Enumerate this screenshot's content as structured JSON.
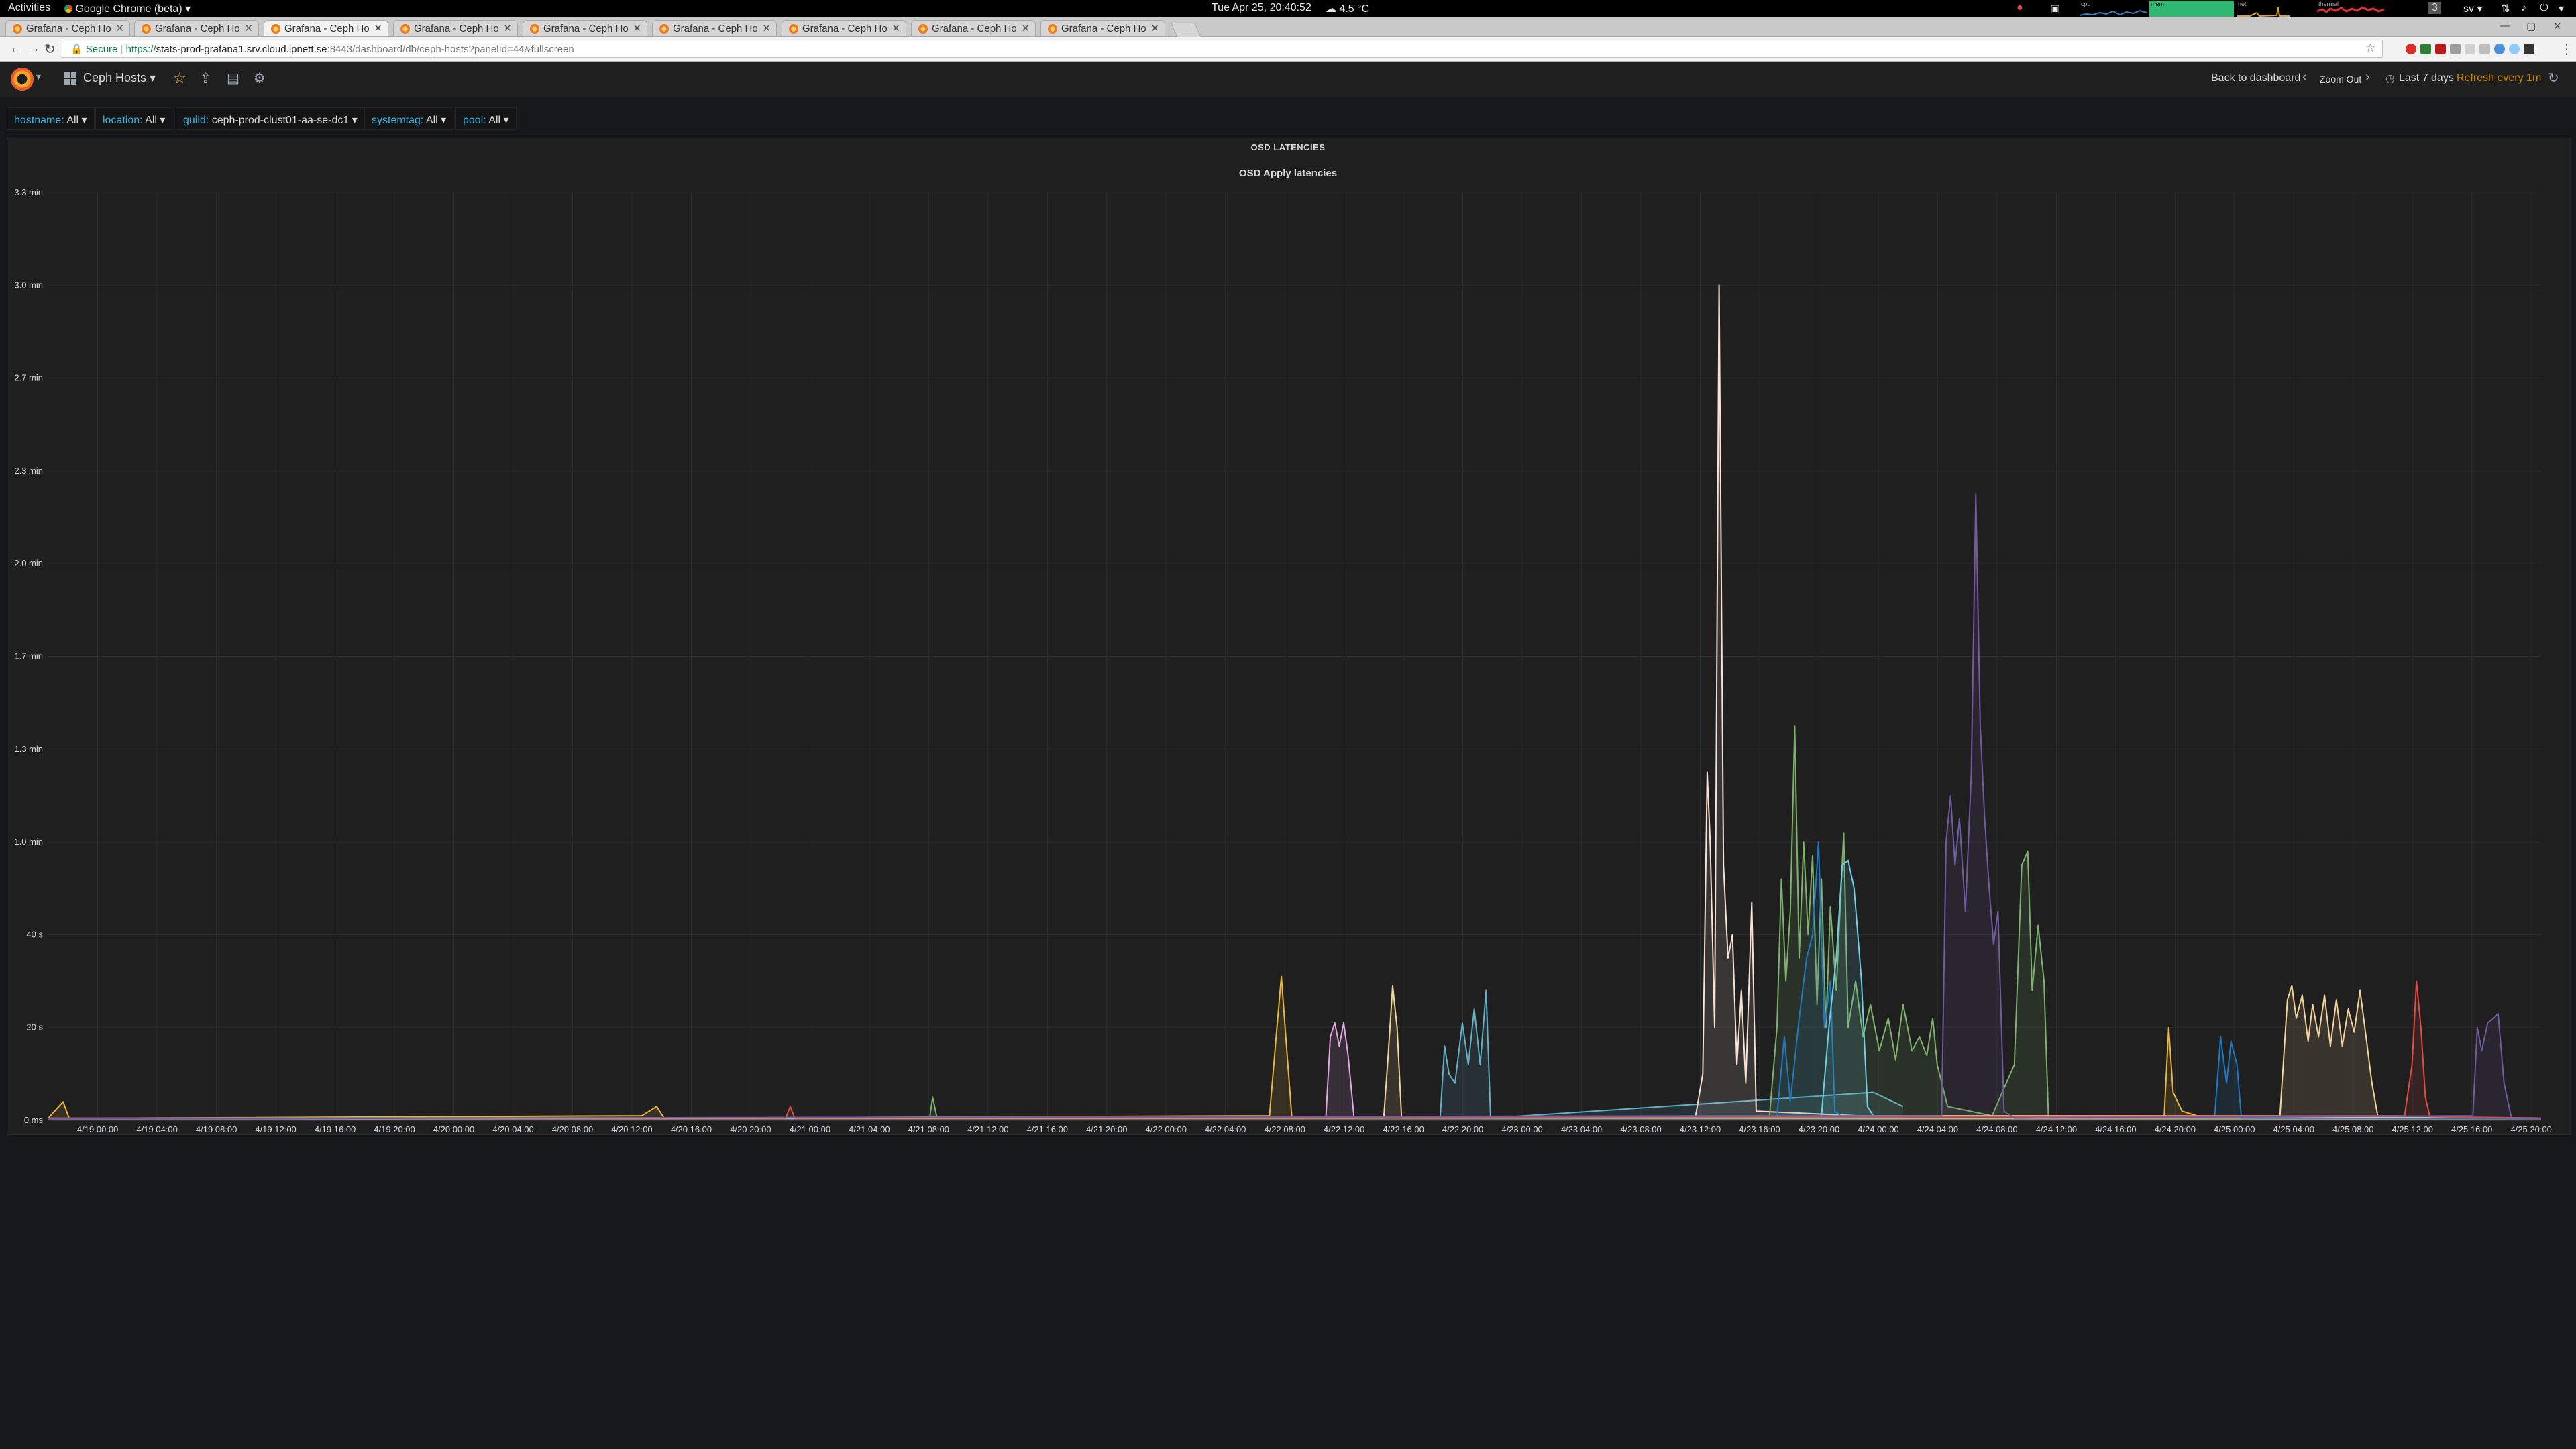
{
  "os_bar": {
    "activities": "Activities",
    "app_menu": "Google Chrome (beta) ▾",
    "clock": "Tue Apr 25, 20:40:52",
    "weather": "4.5 °C",
    "monitor_cpu": "cpu",
    "monitor_mem": "mem",
    "monitor_net": "net",
    "monitor_thermal": "thermal",
    "workspace": "3",
    "keyboard_layout": "sv ▾"
  },
  "browser": {
    "tabs": [
      {
        "title": "Grafana - Ceph Ho"
      },
      {
        "title": "Grafana - Ceph Ho"
      },
      {
        "title": "Grafana - Ceph Ho"
      },
      {
        "title": "Grafana - Ceph Ho"
      },
      {
        "title": "Grafana - Ceph Ho"
      },
      {
        "title": "Grafana - Ceph Ho"
      },
      {
        "title": "Grafana - Ceph Ho"
      },
      {
        "title": "Grafana - Ceph Ho"
      },
      {
        "title": "Grafana - Ceph Ho"
      }
    ],
    "active_tab": 2,
    "security_label": "Secure",
    "url_scheme": "https://",
    "url_host": "stats-prod-grafana1.srv.cloud.ipnett.se",
    "url_path": ":8443/dashboard/db/ceph-hosts?panelId=44&fullscreen"
  },
  "grafana": {
    "dashboard_title": "Ceph Hosts ▾",
    "back_to_dashboard": "Back to dashboard",
    "zoom_out": "Zoom Out",
    "time_range": "Last 7 days",
    "refresh": "Refresh every 1m",
    "refresh_color": "#c98800",
    "variables": [
      {
        "label": "hostname:",
        "value": "All ▾"
      },
      {
        "label": "location:",
        "value": "All ▾"
      },
      {
        "label": "guild:",
        "value": "ceph-prod-clust01-aa-se-dc1 ▾"
      },
      {
        "label": "systemtag:",
        "value": "All ▾"
      },
      {
        "label": "pool:",
        "value": "All ▾"
      }
    ],
    "row_title": "OSD LATENCIES",
    "panel_title": "OSD Apply latencies"
  },
  "chart_data": {
    "type": "line",
    "title": "OSD Apply latencies",
    "y_unit": "seconds",
    "ylim": [
      0,
      200
    ],
    "y_ticks": [
      {
        "v": 0,
        "label": "0 ms"
      },
      {
        "v": 20,
        "label": "20 s"
      },
      {
        "v": 40,
        "label": "40 s"
      },
      {
        "v": 60,
        "label": "1.0 min"
      },
      {
        "v": 80,
        "label": "1.3 min"
      },
      {
        "v": 100,
        "label": "1.7 min"
      },
      {
        "v": 120,
        "label": "2.0 min"
      },
      {
        "v": 140,
        "label": "2.3 min"
      },
      {
        "v": 160,
        "label": "2.7 min"
      },
      {
        "v": 180,
        "label": "3.0 min"
      },
      {
        "v": 200,
        "label": "3.3 min"
      }
    ],
    "x_unit": "hours since 4/18 20:40",
    "xlim": [
      0,
      168
    ],
    "x_ticks": [
      {
        "h": 3.33,
        "label": "4/19 00:00"
      },
      {
        "h": 7.33,
        "label": "4/19 04:00"
      },
      {
        "h": 11.33,
        "label": "4/19 08:00"
      },
      {
        "h": 15.33,
        "label": "4/19 12:00"
      },
      {
        "h": 19.33,
        "label": "4/19 16:00"
      },
      {
        "h": 23.33,
        "label": "4/19 20:00"
      },
      {
        "h": 27.33,
        "label": "4/20 00:00"
      },
      {
        "h": 31.33,
        "label": "4/20 04:00"
      },
      {
        "h": 35.33,
        "label": "4/20 08:00"
      },
      {
        "h": 39.33,
        "label": "4/20 12:00"
      },
      {
        "h": 43.33,
        "label": "4/20 16:00"
      },
      {
        "h": 47.33,
        "label": "4/20 20:00"
      },
      {
        "h": 51.33,
        "label": "4/21 00:00"
      },
      {
        "h": 55.33,
        "label": "4/21 04:00"
      },
      {
        "h": 59.33,
        "label": "4/21 08:00"
      },
      {
        "h": 63.33,
        "label": "4/21 12:00"
      },
      {
        "h": 67.33,
        "label": "4/21 16:00"
      },
      {
        "h": 71.33,
        "label": "4/21 20:00"
      },
      {
        "h": 75.33,
        "label": "4/22 00:00"
      },
      {
        "h": 79.33,
        "label": "4/22 04:00"
      },
      {
        "h": 83.33,
        "label": "4/22 08:00"
      },
      {
        "h": 87.33,
        "label": "4/22 12:00"
      },
      {
        "h": 91.33,
        "label": "4/22 16:00"
      },
      {
        "h": 95.33,
        "label": "4/22 20:00"
      },
      {
        "h": 99.33,
        "label": "4/23 00:00"
      },
      {
        "h": 103.33,
        "label": "4/23 04:00"
      },
      {
        "h": 107.33,
        "label": "4/23 08:00"
      },
      {
        "h": 111.33,
        "label": "4/23 12:00"
      },
      {
        "h": 115.33,
        "label": "4/23 16:00"
      },
      {
        "h": 119.33,
        "label": "4/23 20:00"
      },
      {
        "h": 123.33,
        "label": "4/24 00:00"
      },
      {
        "h": 127.33,
        "label": "4/24 04:00"
      },
      {
        "h": 131.33,
        "label": "4/24 08:00"
      },
      {
        "h": 135.33,
        "label": "4/24 12:00"
      },
      {
        "h": 139.33,
        "label": "4/24 16:00"
      },
      {
        "h": 143.33,
        "label": "4/24 20:00"
      },
      {
        "h": 147.33,
        "label": "4/25 00:00"
      },
      {
        "h": 151.33,
        "label": "4/25 04:00"
      },
      {
        "h": 155.33,
        "label": "4/25 08:00"
      },
      {
        "h": 159.33,
        "label": "4/25 12:00"
      },
      {
        "h": 163.33,
        "label": "4/25 16:00"
      },
      {
        "h": 167.33,
        "label": "4/25 20:00"
      }
    ],
    "grid": true,
    "legend": "none",
    "series": [
      {
        "color": "#eab839",
        "points": [
          [
            0,
            0.5
          ],
          [
            1,
            4
          ],
          [
            1.4,
            0.5
          ],
          [
            6,
            0.5
          ],
          [
            40,
            1
          ],
          [
            41,
            3
          ],
          [
            41.5,
            0.5
          ],
          [
            82.3,
            1
          ],
          [
            82.8,
            20
          ],
          [
            83.1,
            31
          ],
          [
            83.4,
            18
          ],
          [
            83.8,
            0.8
          ],
          [
            93,
            0.5
          ],
          [
            142.6,
            1
          ],
          [
            142.9,
            20
          ],
          [
            143.2,
            6
          ],
          [
            143.8,
            2
          ],
          [
            145,
            0.8
          ],
          [
            168,
            0.5
          ]
        ]
      },
      {
        "color": "#e5a8e2",
        "points": [
          [
            86.1,
            0.5
          ],
          [
            86.4,
            18
          ],
          [
            86.7,
            21
          ],
          [
            87,
            16
          ],
          [
            87.3,
            21
          ],
          [
            87.6,
            14
          ],
          [
            88,
            0.5
          ]
        ]
      },
      {
        "color": "#f4d598",
        "points": [
          [
            0,
            0.3
          ],
          [
            90,
            0.5
          ],
          [
            90.3,
            14
          ],
          [
            90.6,
            29
          ],
          [
            90.9,
            20
          ],
          [
            91.2,
            0.5
          ],
          [
            168,
            0.3
          ]
        ]
      },
      {
        "color": "#64b0c8",
        "points": [
          [
            93.8,
            0.5
          ],
          [
            94.1,
            16
          ],
          [
            94.4,
            10
          ],
          [
            94.8,
            8
          ],
          [
            95.3,
            21
          ],
          [
            95.7,
            12
          ],
          [
            96.1,
            24
          ],
          [
            96.5,
            12
          ],
          [
            96.9,
            28
          ],
          [
            97.2,
            0.5
          ],
          [
            123,
            6
          ],
          [
            125,
            3
          ]
        ]
      },
      {
        "color": "#f9e2d2",
        "points": [
          [
            0,
            0.4
          ],
          [
            111,
            0.6
          ],
          [
            111.5,
            10
          ],
          [
            111.8,
            75
          ],
          [
            112,
            60
          ],
          [
            112.3,
            20
          ],
          [
            112.6,
            180
          ],
          [
            112.9,
            55
          ],
          [
            113.2,
            35
          ],
          [
            113.5,
            40
          ],
          [
            113.8,
            12
          ],
          [
            114.1,
            28
          ],
          [
            114.4,
            8
          ],
          [
            114.8,
            47
          ],
          [
            115.1,
            2
          ],
          [
            122,
            1
          ],
          [
            168,
            0.4
          ]
        ]
      },
      {
        "color": "#7eb26d",
        "points": [
          [
            0,
            0.5
          ],
          [
            59.4,
            0.6
          ],
          [
            59.6,
            5
          ],
          [
            59.9,
            0.5
          ],
          [
            116,
            1
          ],
          [
            116.5,
            20
          ],
          [
            116.8,
            52
          ],
          [
            117.1,
            30
          ],
          [
            117.4,
            45
          ],
          [
            117.7,
            85
          ],
          [
            118,
            35
          ],
          [
            118.3,
            60
          ],
          [
            118.6,
            40
          ],
          [
            118.9,
            57
          ],
          [
            119.2,
            25
          ],
          [
            119.5,
            52
          ],
          [
            119.8,
            20
          ],
          [
            120.1,
            46
          ],
          [
            120.5,
            28
          ],
          [
            121,
            62
          ],
          [
            121.3,
            20
          ],
          [
            121.8,
            30
          ],
          [
            122.3,
            18
          ],
          [
            122.8,
            25
          ],
          [
            123.4,
            15
          ],
          [
            124,
            22
          ],
          [
            124.5,
            13
          ],
          [
            125,
            25
          ],
          [
            125.6,
            15
          ],
          [
            126.1,
            18
          ],
          [
            126.6,
            14
          ],
          [
            127,
            22
          ],
          [
            127.3,
            12
          ],
          [
            128,
            3
          ],
          [
            131,
            1
          ],
          [
            132.5,
            12
          ],
          [
            133,
            55
          ],
          [
            133.4,
            58
          ],
          [
            133.7,
            28
          ],
          [
            134.1,
            42
          ],
          [
            134.5,
            30
          ],
          [
            134.8,
            0.5
          ],
          [
            168,
            0.4
          ]
        ]
      },
      {
        "color": "#1f78c1",
        "points": [
          [
            0,
            0.3
          ],
          [
            116.5,
            1
          ],
          [
            117,
            18
          ],
          [
            117.4,
            4
          ],
          [
            118,
            22
          ],
          [
            118.5,
            35
          ],
          [
            118.9,
            40
          ],
          [
            119.3,
            60
          ],
          [
            119.7,
            20
          ],
          [
            120.1,
            30
          ],
          [
            120.4,
            2
          ],
          [
            120.8,
            1
          ],
          [
            146,
            0.8
          ],
          [
            146.4,
            18
          ],
          [
            146.8,
            8
          ],
          [
            147.1,
            17
          ],
          [
            147.5,
            12
          ],
          [
            147.8,
            0.5
          ],
          [
            168,
            0.3
          ]
        ]
      },
      {
        "color": "#6ed0e0",
        "points": [
          [
            119.5,
            1
          ],
          [
            120,
            20
          ],
          [
            120.5,
            35
          ],
          [
            120.9,
            55
          ],
          [
            121.3,
            56
          ],
          [
            121.7,
            50
          ],
          [
            122.2,
            30
          ],
          [
            122.6,
            3
          ],
          [
            123,
            1
          ]
        ]
      },
      {
        "color": "#f4d598",
        "points": [
          [
            122,
            1
          ],
          [
            150.4,
            1
          ],
          [
            150.9,
            26
          ],
          [
            151.2,
            29
          ],
          [
            151.5,
            22
          ],
          [
            151.9,
            27
          ],
          [
            152.3,
            17
          ],
          [
            152.6,
            25
          ],
          [
            153,
            18
          ],
          [
            153.4,
            27
          ],
          [
            153.8,
            16
          ],
          [
            154.2,
            26
          ],
          [
            154.6,
            16
          ],
          [
            155,
            24
          ],
          [
            155.4,
            19
          ],
          [
            155.8,
            28
          ],
          [
            156.2,
            18
          ],
          [
            156.6,
            8
          ],
          [
            157,
            0.8
          ]
        ]
      },
      {
        "color": "#e24d42",
        "points": [
          [
            0,
            0.5
          ],
          [
            49.7,
            0.5
          ],
          [
            50,
            3
          ],
          [
            50.3,
            0.5
          ],
          [
            158.8,
            1
          ],
          [
            159.3,
            12
          ],
          [
            159.6,
            30
          ],
          [
            159.9,
            20
          ],
          [
            160.2,
            5
          ],
          [
            160.5,
            0.8
          ],
          [
            168,
            0.5
          ]
        ]
      },
      {
        "color": "#705da0",
        "points": [
          [
            0,
            0.4
          ],
          [
            127.6,
            1
          ],
          [
            127.9,
            60
          ],
          [
            128.2,
            70
          ],
          [
            128.5,
            55
          ],
          [
            128.8,
            65
          ],
          [
            129.2,
            45
          ],
          [
            129.6,
            75
          ],
          [
            129.9,
            135
          ],
          [
            130.2,
            85
          ],
          [
            130.5,
            65
          ],
          [
            130.8,
            50
          ],
          [
            131.1,
            38
          ],
          [
            131.4,
            45
          ],
          [
            131.8,
            2
          ],
          [
            132.5,
            0.5
          ],
          [
            163.4,
            1
          ],
          [
            163.7,
            20
          ],
          [
            164,
            15
          ],
          [
            164.4,
            21
          ],
          [
            164.8,
            22
          ],
          [
            165.1,
            23
          ],
          [
            165.5,
            8
          ],
          [
            166,
            0.5
          ],
          [
            168,
            0.4
          ]
        ]
      }
    ]
  }
}
